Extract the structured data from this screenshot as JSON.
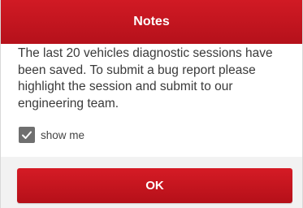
{
  "dialog": {
    "title": "Notes",
    "message": "The last 20 vehicles diagnostic sessions have been saved. To submit a bug report please highlight the session and submit to our engineering team.",
    "checkbox": {
      "label": "show me",
      "checked": true
    },
    "ok_label": "OK"
  },
  "colors": {
    "accent_red": "#c4151f",
    "checkbox_gray": "#6f6f6f",
    "footer_bg": "#f2f2f2"
  },
  "icons": {
    "checkbox": "checkmark-icon"
  }
}
